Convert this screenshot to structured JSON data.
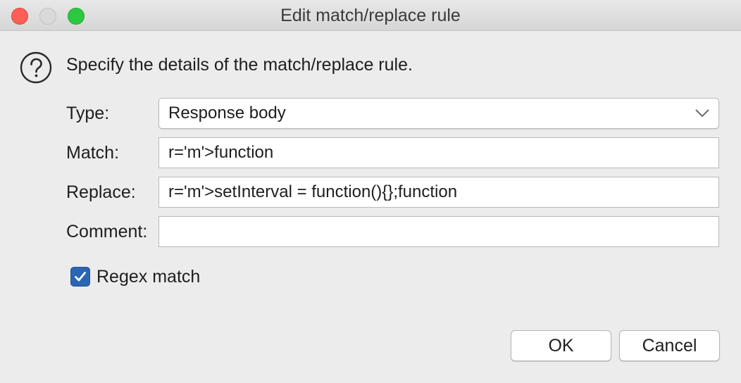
{
  "window": {
    "title": "Edit match/replace rule"
  },
  "dialog": {
    "prompt": "Specify the details of the match/replace rule.",
    "icon": "question-mark-icon"
  },
  "form": {
    "type_label": "Type:",
    "type_value": "Response body",
    "match_label": "Match:",
    "match_value": "r='m'>function",
    "replace_label": "Replace:",
    "replace_value": "r='m'>setInterval = function(){};function",
    "comment_label": "Comment:",
    "comment_value": ""
  },
  "options": {
    "regex_label": "Regex match",
    "regex_checked": true
  },
  "buttons": {
    "ok_label": "OK",
    "cancel_label": "Cancel"
  },
  "colors": {
    "close": "#fd5f57",
    "minimize_disabled": "#d9d9d9",
    "maximize": "#2bc840",
    "checkbox_accent": "#2b66b4"
  }
}
